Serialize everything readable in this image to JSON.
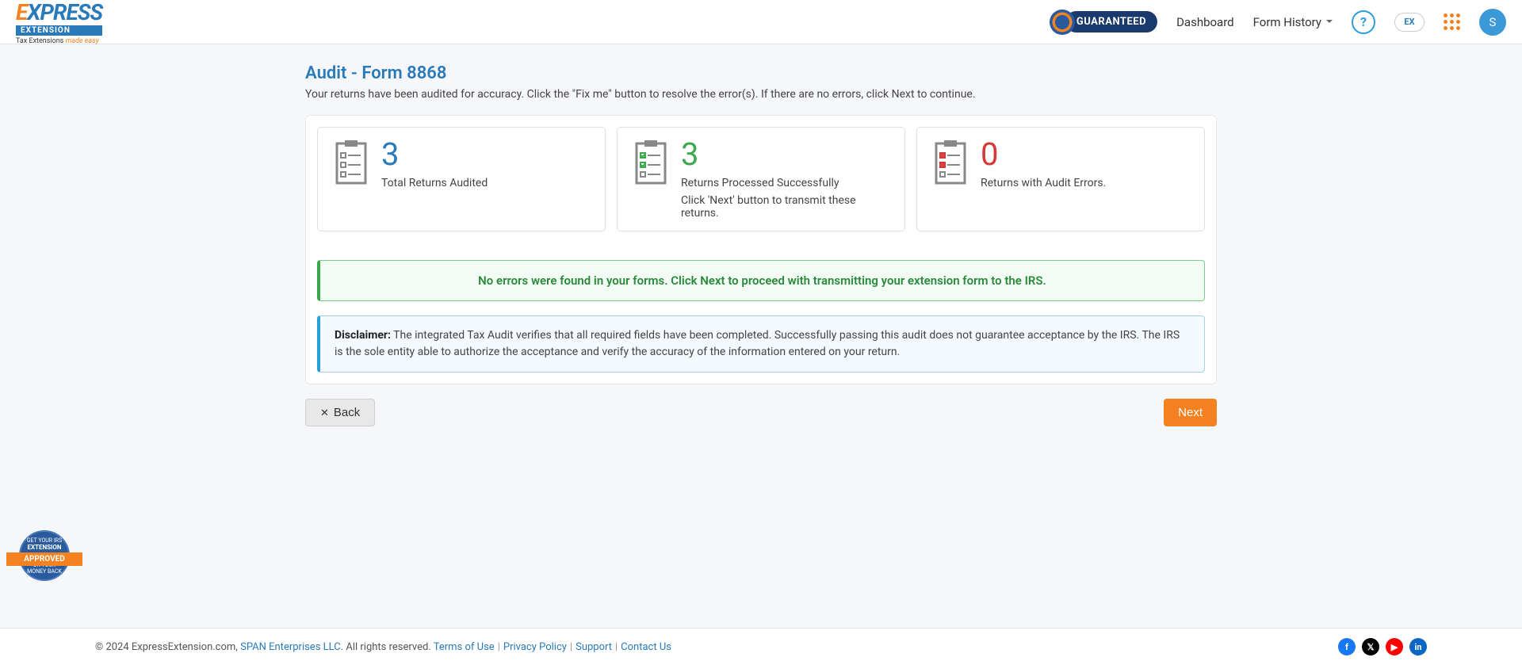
{
  "header": {
    "logo_text": "EXPRESS",
    "logo_sub": "EXTENSION",
    "logo_tagline_a": "Tax Extensions",
    "logo_tagline_b": "made easy",
    "guarantee": "GUARANTEED",
    "nav_dashboard": "Dashboard",
    "nav_form_history": "Form History",
    "help": "?",
    "ex_badge": "EX",
    "avatar_initial": "S"
  },
  "page": {
    "title": "Audit - Form 8868",
    "description": "Your returns have been audited for accuracy. Click the \"Fix me\" button to resolve the error(s). If there are no errors, click Next to continue."
  },
  "stats": {
    "audited": {
      "count": "3",
      "label": "Total Returns Audited"
    },
    "success": {
      "count": "3",
      "label": "Returns Processed Successfully",
      "sub": "Click 'Next' button to transmit these returns."
    },
    "errors": {
      "count": "0",
      "label": "Returns with Audit Errors."
    }
  },
  "success_banner": "No errors were found in your forms. Click Next to proceed with transmitting your extension form to the IRS.",
  "disclaimer": {
    "label": "Disclaimer:",
    "text": "The integrated Tax Audit verifies that all required fields have been completed. Successfully passing this audit does not guarantee acceptance by the IRS. The IRS is the sole entity able to authorize the acceptance and verify the accuracy of the information entered on your return."
  },
  "buttons": {
    "back": "Back",
    "next": "Next"
  },
  "approved_badge": {
    "line1": "GET YOUR IRS",
    "line2": "EXTENSION",
    "ribbon": "APPROVED",
    "line3": "OR YOUR",
    "line4": "MONEY BACK"
  },
  "footer": {
    "copyright": "© 2024 ExpressExtension.com, ",
    "company": "SPAN Enterprises LLC",
    "rights": ". All rights reserved. ",
    "terms": "Terms of Use",
    "privacy": "Privacy Policy",
    "support": "Support",
    "contact": "Contact Us"
  }
}
